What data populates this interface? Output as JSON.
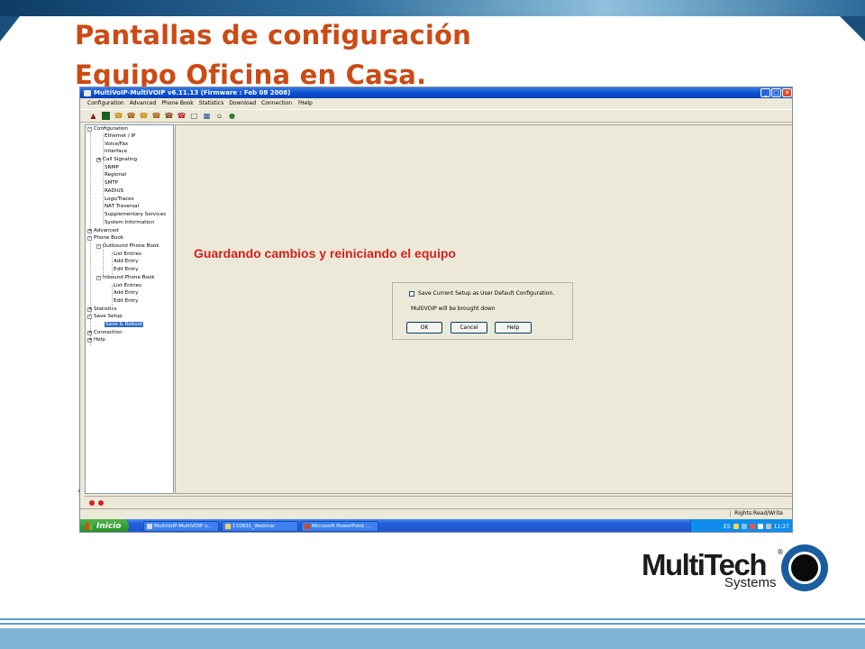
{
  "slide": {
    "title_line1": "Pantallas de configuración",
    "title_line2": "Equipo Oficina en Casa.",
    "logo_word": "MultiTech",
    "logo_sub": "Systems",
    "logo_reg": "®"
  },
  "window": {
    "title": "MultiVoIP-MultiVOIP v6.11.13 (Firmware : Feb 08 2008)",
    "controls": {
      "minimize": "_",
      "maximize": "□",
      "close": "✕"
    }
  },
  "menu": [
    "Configuration",
    "Advanced",
    "Phone Book",
    "Statistics",
    "Download",
    "Connection",
    "?Help"
  ],
  "toolbar_icons": [
    "network-icon",
    "terminal-icon",
    "phone-icon",
    "phone-icon",
    "phone-icon",
    "phone-icon",
    "phone-icon",
    "phone-icon",
    "document-icon",
    "chart-icon",
    "house-icon",
    "globe-icon"
  ],
  "tree": {
    "configuration": "Configuration",
    "ethernet": "Ethernet / IP",
    "voice_fax": "Voice/Fax",
    "interface": "Interface",
    "call_signaling": "Call Signaling",
    "snmp": "SNMP",
    "regional": "Regional",
    "smtp": "SMTP",
    "radius": "RADIUS",
    "logs": "Logs/Traces",
    "nat": "NAT Traversal",
    "supplementary": "Supplementary Services",
    "sysinfo": "System Information",
    "advanced": "Advanced",
    "phone_book": "Phone Book",
    "outbound": "Outbound Phone Book",
    "out_list": "List Entries",
    "out_add": "Add Entry",
    "out_edit": "Edit Entry",
    "inbound": "Inbound Phone Book",
    "in_list": "List Entries",
    "in_add": "Add Entry",
    "in_edit": "Edit Entry",
    "statistics": "Statistics",
    "save_setup": "Save Setup",
    "save_reboot": "Save & Reboot",
    "connection": "Connection",
    "help": "Help"
  },
  "annotation": "Guardando cambios y reiniciando el equipo",
  "dialog": {
    "checkbox_label": "Save Current Setup as User Default Configuration.",
    "message": "MultiVOIP will be brought down",
    "ok": "OK",
    "cancel": "Cancel",
    "help": "Help"
  },
  "status": {
    "rights": "Rights:Read/Write"
  },
  "taskbar": {
    "start": "Inicio",
    "tasks": [
      "MultiVoIP-MultiVOIP v...",
      "110831_Webinar",
      "Microsoft PowerPoint ..."
    ],
    "tray_lang": "ES",
    "clock": "11:27"
  },
  "colors": {
    "title": "#cc4a14",
    "annotation": "#d42020",
    "xp_blue": "#0a4fd4"
  }
}
